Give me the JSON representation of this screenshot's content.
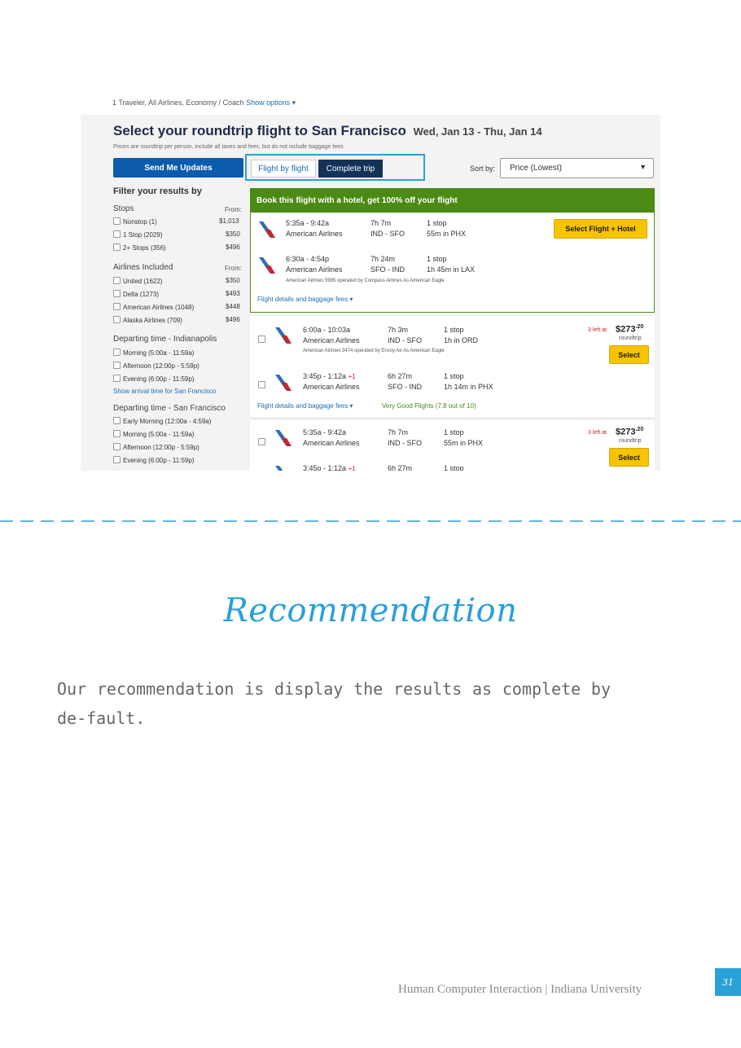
{
  "top_line": {
    "text": "1 Traveler, All Airlines, Economy / Coach",
    "link": "Show options ▾"
  },
  "screen": {
    "title": "Select your roundtrip flight to San Francisco",
    "dates": "Wed, Jan 13 - Thu, Jan 14",
    "note": "Prices are roundtrip per person, include all taxes and fees, but do not include baggage fees.",
    "send_updates": "Send Me Updates",
    "toggle_a": "Flight by flight",
    "toggle_b": "Complete trip",
    "sort_label": "Sort by:",
    "sort_value": "Price (Lowest)"
  },
  "filters": {
    "heading": "Filter your results by",
    "stops": {
      "title": "Stops",
      "from": "From:",
      "items": [
        {
          "label": "Nonstop (1)",
          "price": "$1,013"
        },
        {
          "label": "1 Stop (2029)",
          "price": "$350"
        },
        {
          "label": "2+ Stops (356)",
          "price": "$496"
        }
      ]
    },
    "airlines": {
      "title": "Airlines Included",
      "from": "From:",
      "items": [
        {
          "label": "United (1622)",
          "price": "$350"
        },
        {
          "label": "Delta (1273)",
          "price": "$493"
        },
        {
          "label": "American Airlines (1048)",
          "price": "$448"
        },
        {
          "label": "Alaska Airlines (709)",
          "price": "$496"
        }
      ]
    },
    "depart_ind": {
      "title": "Departing time - Indianapolis",
      "items": [
        "Morning (5:00a - 11:59a)",
        "Afternoon (12:00p - 5:59p)",
        "Evening (6:00p - 11:59p)"
      ],
      "link": "Show arrival time for San Francisco"
    },
    "depart_sfo": {
      "title": "Departing time - San Francisco",
      "items": [
        "Early Morning (12:00a - 4:59a)",
        "Morning (5:00a - 11:59a)",
        "Afternoon (12:00p - 5:59p)",
        "Evening (6:00p - 11:59p)"
      ]
    }
  },
  "hotel_card": {
    "header": "Book this flight with a hotel, get 100% off your flight",
    "button": "Select Flight + Hotel",
    "legs": [
      {
        "time": "5:35a - 9:42a",
        "airline": "American Airlines",
        "dur": "7h 7m",
        "route": "IND - SFO",
        "stops": "1 stop",
        "via": "55m in PHX"
      },
      {
        "time": "6:30a - 4:54p",
        "airline": "American Airlines",
        "dur": "7h 24m",
        "route": "SFO - IND",
        "stops": "1 stop",
        "via": "1h 45m in LAX"
      }
    ],
    "operated": "American Airlines 5995 operated by Compass Airlines As American Eagle",
    "details": "Flight details and baggage fees ▾"
  },
  "result1": {
    "legs": [
      {
        "time": "6:00a - 10:03a",
        "airline": "American Airlines",
        "dur": "7h 3m",
        "route": "IND - SFO",
        "stops": "1 stop",
        "via": "1h in ORD"
      },
      {
        "time": "3:45p - 1:12a",
        "plus": "+1",
        "airline": "American Airlines",
        "dur": "6h 27m",
        "route": "SFO - IND",
        "stops": "1 stop",
        "via": "1h 14m in PHX"
      }
    ],
    "operated": "American Airlines 3474 operated by Envoy Air As American Eagle",
    "left": "3 left at",
    "price": "$273",
    "cents": ".20",
    "per": "roundtrip",
    "select": "Select",
    "details": "Flight details and baggage fees ▾",
    "rating": "Very Good Flights (7.8 out of 10)"
  },
  "result2": {
    "legs": [
      {
        "time": "5:35a - 9:42a",
        "airline": "American Airlines",
        "dur": "7h 7m",
        "route": "IND - SFO",
        "stops": "1 stop",
        "via": "55m in PHX"
      },
      {
        "time": "3:45p - 1:12a",
        "plus": "+1",
        "dur": "6h 27m",
        "stops": "1 stop"
      }
    ],
    "left": "3 left at",
    "price": "$273",
    "cents": ".20",
    "per": "roundtrip",
    "select": "Select"
  },
  "recommendation": {
    "title": "Recommendation",
    "text": "Our recommendation is display the results as complete by de-fault."
  },
  "footer": {
    "text": "Human Computer Interaction | Indiana University",
    "page": "31"
  },
  "colors": {
    "accent": "#2aa1d8",
    "nav_blue": "#0d5bad",
    "hotel_green": "#4b8a14",
    "select_yellow": "#f8c300"
  }
}
